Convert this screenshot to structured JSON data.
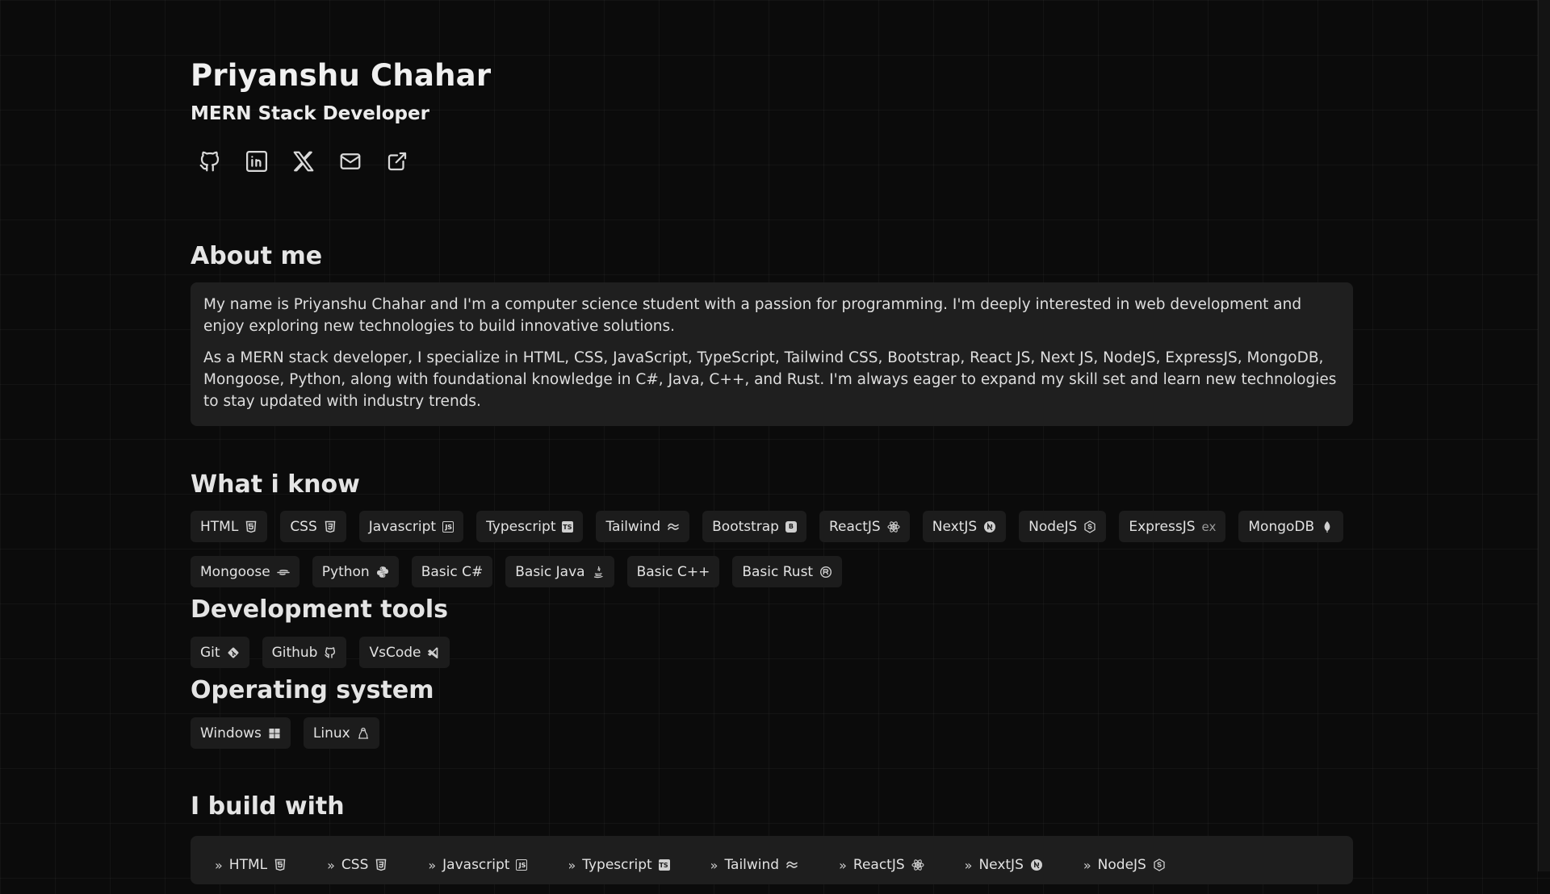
{
  "profile": {
    "name": "Priyanshu Chahar",
    "role": "MERN Stack Developer"
  },
  "socials": [
    {
      "icon": "github-icon"
    },
    {
      "icon": "linkedin-icon"
    },
    {
      "icon": "x-twitter-icon"
    },
    {
      "icon": "mail-icon"
    },
    {
      "icon": "external-link-icon"
    }
  ],
  "about": {
    "heading": "About me",
    "p1": "My name is Priyanshu Chahar and I'm a computer science student with a passion for programming. I'm deeply interested in web development and enjoy exploring new technologies to build innovative solutions.",
    "p2": "As a MERN stack developer, I specialize in HTML, CSS, JavaScript, TypeScript, Tailwind CSS, Bootstrap, React JS, Next JS, NodeJS, ExpressJS, MongoDB, Mongoose, Python, along with foundational knowledge in C#, Java, C++, and Rust. I'm always eager to expand my skill set and learn new technologies to stay updated with industry trends."
  },
  "skills": {
    "heading": "What i know",
    "row1": [
      {
        "label": "HTML",
        "icon": "html5-icon"
      },
      {
        "label": "CSS",
        "icon": "css3-icon"
      },
      {
        "label": "Javascript",
        "icon": "js-icon"
      },
      {
        "label": "Typescript",
        "icon": "ts-icon"
      },
      {
        "label": "Tailwind",
        "icon": "tailwind-icon"
      },
      {
        "label": "Bootstrap",
        "icon": "bootstrap-icon"
      },
      {
        "label": "ReactJS",
        "icon": "react-icon"
      },
      {
        "label": "NextJS",
        "icon": "nextjs-icon"
      },
      {
        "label": "NodeJS",
        "icon": "nodejs-icon"
      },
      {
        "label": "ExpressJS",
        "icon": "express-icon",
        "icon_text": "ex"
      },
      {
        "label": "MongoDB",
        "icon": "mongodb-icon"
      }
    ],
    "row2": [
      {
        "label": "Mongoose",
        "icon": "mongoose-icon"
      },
      {
        "label": "Python",
        "icon": "python-icon"
      },
      {
        "label": "Basic C#",
        "icon": ""
      },
      {
        "label": "Basic Java",
        "icon": "java-icon"
      },
      {
        "label": "Basic C++",
        "icon": ""
      },
      {
        "label": "Basic Rust",
        "icon": "rust-icon"
      }
    ]
  },
  "tools": {
    "heading": "Development tools",
    "items": [
      {
        "label": "Git",
        "icon": "git-icon"
      },
      {
        "label": "Github",
        "icon": "github-icon"
      },
      {
        "label": "VsCode",
        "icon": "vscode-icon"
      }
    ]
  },
  "os": {
    "heading": "Operating system",
    "items": [
      {
        "label": "Windows",
        "icon": "windows-icon"
      },
      {
        "label": "Linux",
        "icon": "linux-icon"
      }
    ]
  },
  "build": {
    "heading": "I build with",
    "items": [
      {
        "label": "HTML",
        "icon": "html5-icon"
      },
      {
        "label": "CSS",
        "icon": "css3-icon"
      },
      {
        "label": "Javascript",
        "icon": "js-icon"
      },
      {
        "label": "Typescript",
        "icon": "ts-icon"
      },
      {
        "label": "Tailwind",
        "icon": "tailwind-icon"
      },
      {
        "label": "ReactJS",
        "icon": "react-icon"
      },
      {
        "label": "NextJS",
        "icon": "nextjs-icon"
      },
      {
        "label": "NodeJS",
        "icon": "nodejs-icon"
      }
    ]
  }
}
